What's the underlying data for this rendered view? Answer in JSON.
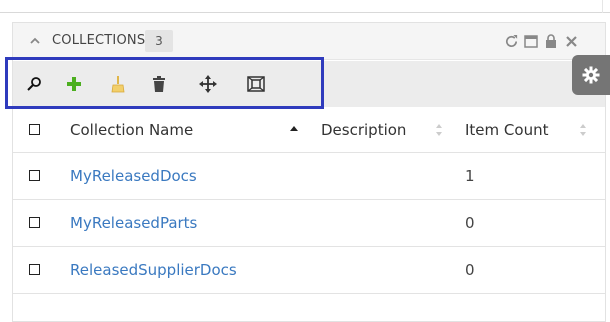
{
  "panel": {
    "title": "COLLECTIONS",
    "count": "3"
  },
  "toolbar": {
    "buttons": [
      "search-icon",
      "add-icon",
      "clear-filter-icon",
      "delete-icon",
      "move-icon",
      "fit-to-screen-icon"
    ]
  },
  "table": {
    "columns": [
      "Collection Name",
      "Description",
      "Item Count"
    ],
    "rows": [
      {
        "name": "MyReleasedDocs",
        "description": "",
        "count": "1"
      },
      {
        "name": "MyReleasedParts",
        "description": "",
        "count": "0"
      },
      {
        "name": "ReleasedSupplierDocs",
        "description": "",
        "count": "0"
      }
    ]
  },
  "colors": {
    "link": "#3a79c0",
    "highlight": "#2f3bbd",
    "add": "#4caf1f"
  }
}
